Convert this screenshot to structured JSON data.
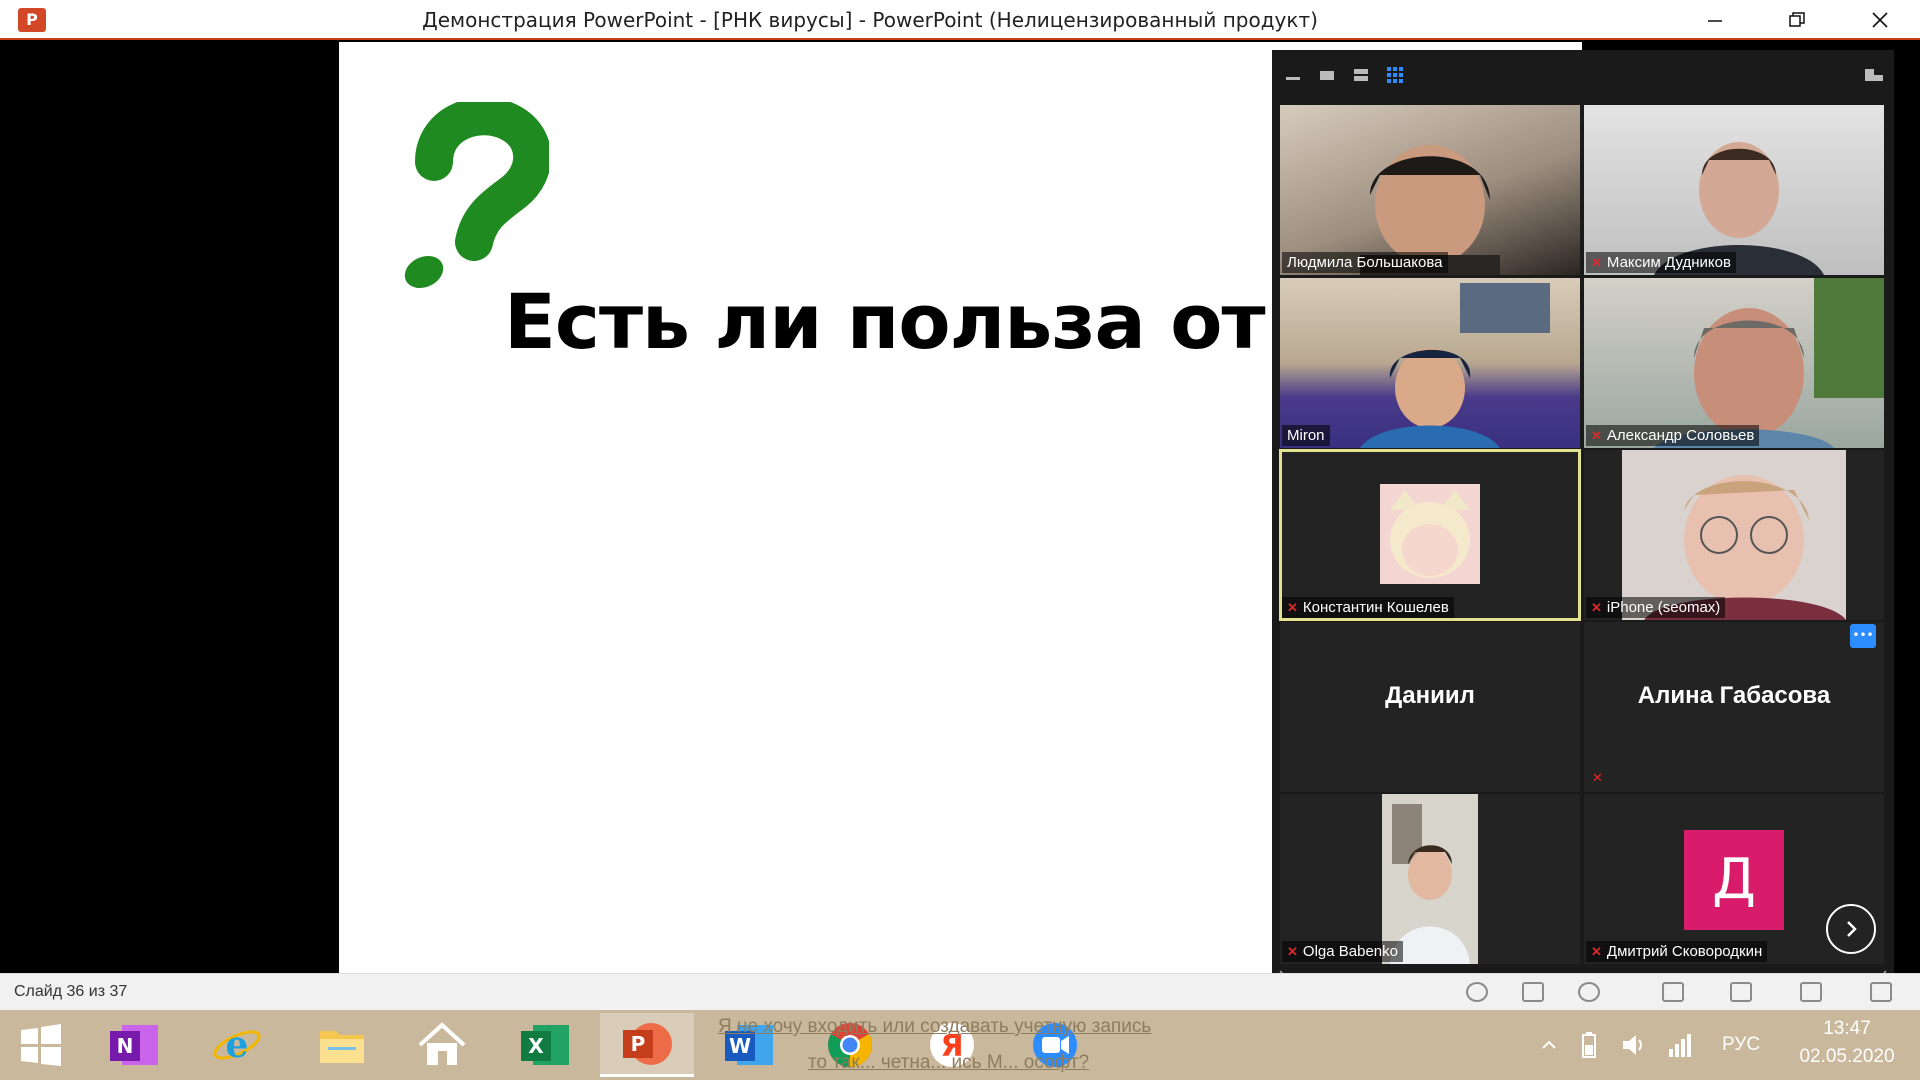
{
  "window": {
    "title": "Демонстрация PowerPoint - [РНК вирусы] - PowerPoint (Нелицензированный продукт)",
    "app_icon_letter": "P",
    "brand_color": "#d24726"
  },
  "slide": {
    "title": "Есть ли польза от вир",
    "question_mark": "?",
    "question_color": "#1f8a1f"
  },
  "zoom": {
    "participants": [
      {
        "name": "Людмила Большакова",
        "muted": false,
        "video": true
      },
      {
        "name": "Максим Дудников",
        "muted": true,
        "video": true
      },
      {
        "name": "Miron",
        "muted": false,
        "video": true
      },
      {
        "name": "Александр Соловьев",
        "muted": true,
        "video": true
      },
      {
        "name": "Константин Кошелев",
        "muted": true,
        "video": true,
        "active_speaker": true
      },
      {
        "name": "iPhone (seomax)",
        "muted": true,
        "video": true
      },
      {
        "name": "Даниил",
        "muted": false,
        "video": false
      },
      {
        "name": "Алина Габасова",
        "muted": true,
        "video": false
      },
      {
        "name": "Olga Babenko",
        "muted": true,
        "video": true
      },
      {
        "name": "Дмитрий Сковородкин",
        "muted": true,
        "video": false,
        "avatar_letter": "Д",
        "avatar_color": "#d81b6a"
      }
    ],
    "more_button": "•••"
  },
  "status_bar": {
    "slide_counter": "Слайд 36 из 37"
  },
  "taskbar": {
    "link_line1": "Я не хочу входить или создавать учетную запись",
    "link_line2": "то так... четна... ись М... ософт?",
    "language": "РУС",
    "time": "13:47",
    "date": "02.05.2020",
    "apps": [
      "start",
      "onenote",
      "internet-explorer",
      "file-explorer",
      "home",
      "excel",
      "powerpoint",
      "word",
      "chrome",
      "yandex",
      "zoom"
    ]
  }
}
